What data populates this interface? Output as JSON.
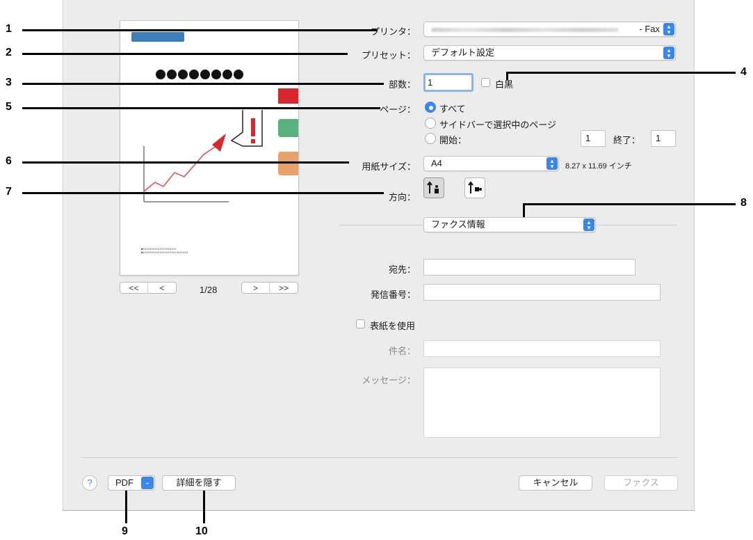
{
  "preview": {
    "page_indicator": "1/28",
    "first_label": "<<",
    "prev_label": "<",
    "next_label": ">",
    "last_label": ">>"
  },
  "form": {
    "printer": {
      "label": "プリンタ：",
      "value_suffix": "- Fax"
    },
    "preset": {
      "label": "プリセット：",
      "value": "デフォルト設定"
    },
    "copies": {
      "label": "部数：",
      "value": "1",
      "bw_label": "白黒"
    },
    "pages": {
      "label": "ページ：",
      "all": "すべて",
      "selected": "サイドバーで選択中のページ",
      "from": "開始：",
      "from_value": "1",
      "to_label": "終了：",
      "to_value": "1"
    },
    "paper_size": {
      "label": "用紙サイズ：",
      "value": "A4",
      "dimension": "8.27 x 11.69 インチ"
    },
    "orientation": {
      "label": "方向："
    },
    "section_popup": "ファクス情報",
    "fax": {
      "to_label": "宛先：",
      "sender_label": "発信番号：",
      "cover_label": "表紙を使用",
      "subject_label": "件名：",
      "message_label": "メッセージ："
    }
  },
  "footer": {
    "help": "?",
    "pdf": "PDF",
    "hide_details": "詳細を隠す",
    "cancel": "キャンセル",
    "fax": "ファクス"
  },
  "callouts": [
    "1",
    "2",
    "3",
    "4",
    "5",
    "6",
    "7",
    "8",
    "9",
    "10"
  ],
  "colors": {
    "accent": "#3a86f0",
    "dialog_bg": "#ececec"
  }
}
